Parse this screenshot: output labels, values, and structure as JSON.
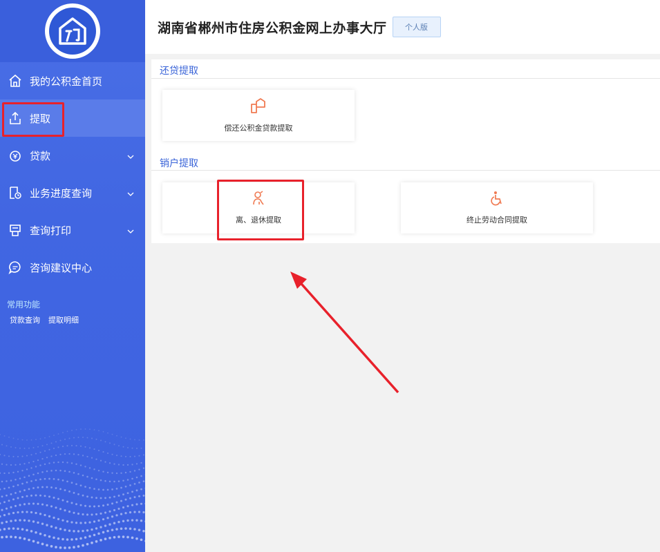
{
  "sidebar": {
    "menu": [
      {
        "label": "我的公积金首页",
        "icon": "home-icon"
      },
      {
        "label": "提取",
        "icon": "upload-icon"
      },
      {
        "label": "贷款",
        "icon": "loan-icon"
      },
      {
        "label": "业务进度查询",
        "icon": "progress-icon"
      },
      {
        "label": "查询打印",
        "icon": "print-icon"
      },
      {
        "label": "咨询建议中心",
        "icon": "chat-icon"
      }
    ],
    "common_title": "常用功能",
    "common_links": [
      "贷款查询",
      "提取明细"
    ]
  },
  "header": {
    "title": "湖南省郴州市住房公积金网上办事大厅",
    "personal_label": "个人版"
  },
  "sections": [
    {
      "title": "还贷提取",
      "cards": [
        {
          "label": "偿还公积金贷款提取",
          "icon": "house-repay-icon"
        }
      ]
    },
    {
      "title": "销户提取",
      "cards": [
        {
          "label": "离、退休提取",
          "icon": "retiree-icon"
        },
        {
          "label": "终止劳动合同提取",
          "icon": "wheelchair-icon"
        }
      ]
    }
  ],
  "colors": {
    "sidebar": "#4166e2",
    "accent": "#3a64d8",
    "highlight": "#e8212b",
    "card_icon": "#f07a52"
  }
}
